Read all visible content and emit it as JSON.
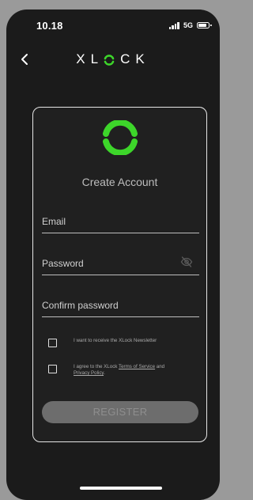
{
  "status_bar": {
    "time": "10.18",
    "network": "5G",
    "signal_icon": "signal-bars-icon",
    "battery_icon": "battery-icon"
  },
  "nav": {
    "back_icon": "chevron-left-icon",
    "brand_left": "XL",
    "brand_right": "CK",
    "brand_logo_icon": "xlock-o-icon"
  },
  "card": {
    "logo_icon": "xlock-logo-icon",
    "title": "Create Account",
    "email": {
      "placeholder": "Email",
      "value": ""
    },
    "password": {
      "placeholder": "Password",
      "value": "",
      "toggle_icon": "eye-off-icon"
    },
    "confirm_password": {
      "placeholder": "Confirm password",
      "value": ""
    },
    "newsletter_label": "I want to receive the XLock Newsletter",
    "terms": {
      "prefix": "I agree to the XLock ",
      "terms_link": "Terms of Service",
      "middle": " and ",
      "privacy_link": "Privacy Policy",
      "suffix": "."
    },
    "register_label": "REGISTER"
  },
  "colors": {
    "brand_green": "#3dd62a",
    "background": "#1b1b1b",
    "card_border": "#e6e6e6",
    "register_button": "#6d6d6d"
  }
}
